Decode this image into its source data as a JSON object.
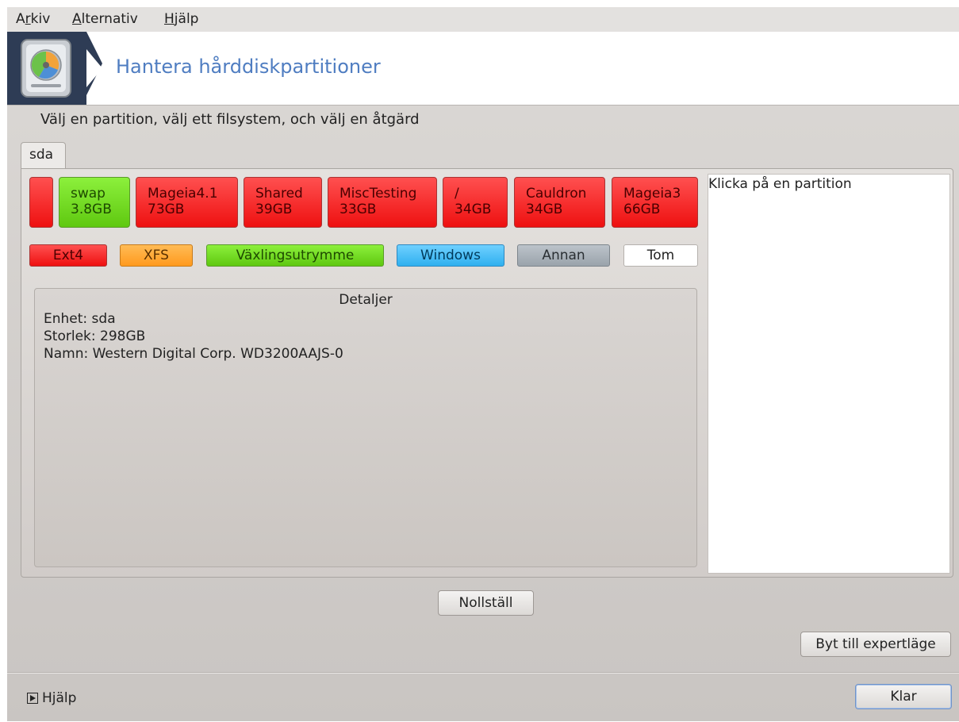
{
  "menu": {
    "items": [
      {
        "pre": "A",
        "key": "r",
        "post": "kiv"
      },
      {
        "pre": "",
        "key": "A",
        "post": "lternativ"
      },
      {
        "pre": "",
        "key": "H",
        "post": "jälp"
      }
    ]
  },
  "banner": {
    "title": "Hantera hårddiskpartitioner",
    "icon": "harddisk-icon"
  },
  "instruction": "Välj en partition, välj ett filsystem, och välj en åtgärd",
  "tab": {
    "label": "sda"
  },
  "partitions": [
    {
      "name": "",
      "size": "",
      "type": "Ext4",
      "color": "#ff2a2a"
    },
    {
      "name": "swap",
      "size": "3.8GB",
      "type": "Växlingsutrymme",
      "color": "#6fdc1e"
    },
    {
      "name": "Mageia4.1",
      "size": "73GB",
      "type": "Ext4",
      "color": "#ff2a2a"
    },
    {
      "name": "Shared",
      "size": "39GB",
      "type": "Ext4",
      "color": "#ff2a2a"
    },
    {
      "name": "MiscTesting",
      "size": "33GB",
      "type": "Ext4",
      "color": "#ff2a2a"
    },
    {
      "name": "/",
      "size": "34GB",
      "type": "Ext4",
      "color": "#ff2a2a"
    },
    {
      "name": "Cauldron",
      "size": "34GB",
      "type": "Ext4",
      "color": "#ff2a2a"
    },
    {
      "name": "Mageia3",
      "size": "66GB",
      "type": "Ext4",
      "color": "#ff2a2a"
    }
  ],
  "legend": [
    {
      "label": "Ext4",
      "color": "#ff2a2a"
    },
    {
      "label": "XFS",
      "color": "#ffa52a"
    },
    {
      "label": "Växlingsutrymme",
      "color": "#6fdc1e"
    },
    {
      "label": "Windows",
      "color": "#3cb8f5"
    },
    {
      "label": "Annan",
      "color": "#a5adb5"
    },
    {
      "label": "Tom",
      "color": "#ffffff"
    }
  ],
  "details": {
    "title": "Detaljer",
    "lines": [
      "Enhet: sda",
      "Storlek: 298GB",
      "Namn: Western Digital Corp. WD3200AAJS-0"
    ]
  },
  "info_panel": {
    "text": "Klicka på en partition"
  },
  "buttons": {
    "reset": "Nollställ",
    "expert": "Byt till expertläge",
    "done": "Klar",
    "help": "Hjälp"
  }
}
